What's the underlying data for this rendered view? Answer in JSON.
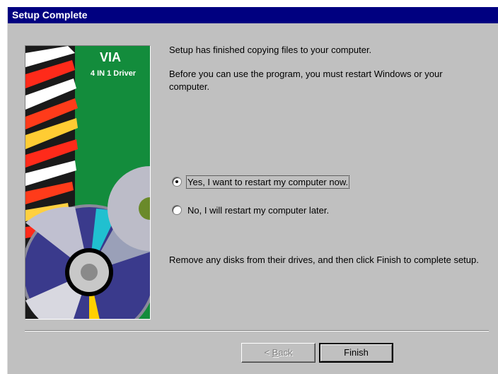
{
  "window": {
    "title": "Setup Complete"
  },
  "artwork": {
    "brand": "VIA",
    "product": "4 IN 1 Driver"
  },
  "messages": {
    "line1": "Setup has finished copying files to your computer.",
    "line2": "Before you can use the program, you must restart Windows or your computer.",
    "line3": "Remove any disks from their drives, and then click Finish to complete setup."
  },
  "options": [
    {
      "label": "Yes, I want to restart my computer now.",
      "checked": true
    },
    {
      "label": "No, I will restart my computer later.",
      "checked": false
    }
  ],
  "buttons": {
    "back_accel": "B",
    "back_rest": "ack",
    "back_prefix": "< ",
    "finish": "Finish"
  }
}
